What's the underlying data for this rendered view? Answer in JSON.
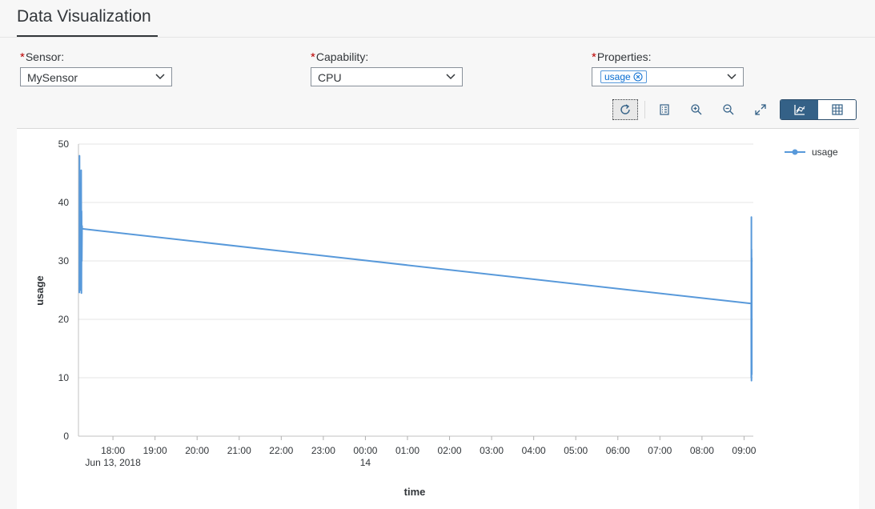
{
  "header": {
    "title": "Data Visualization"
  },
  "filters": {
    "sensor": {
      "label": "Sensor:",
      "required": "*",
      "value": "MySensor"
    },
    "capability": {
      "label": "Capability:",
      "required": "*",
      "value": "CPU"
    },
    "properties": {
      "label": "Properties:",
      "required": "*",
      "tokens": [
        "usage"
      ]
    }
  },
  "toolbar": {
    "icons": [
      "refresh-icon",
      "legend-list-icon",
      "zoom-in-icon",
      "zoom-out-icon",
      "fullscreen-icon",
      "chart-view-icon",
      "table-view-icon"
    ],
    "active_view": "chart"
  },
  "colors": {
    "accent": "#5899da",
    "active_segment": "#346187",
    "required": "#bb0000"
  },
  "chart_data": {
    "type": "line",
    "xlabel": "time",
    "ylabel": "usage",
    "ylim": [
      0,
      50
    ],
    "yticks": [
      0,
      10,
      20,
      30,
      40,
      50
    ],
    "xticks": [
      {
        "label": "18:00",
        "sub": "Jun 13, 2018",
        "t": 18.0
      },
      {
        "label": "19:00",
        "sub": "",
        "t": 19.0
      },
      {
        "label": "20:00",
        "sub": "",
        "t": 20.0
      },
      {
        "label": "21:00",
        "sub": "",
        "t": 21.0
      },
      {
        "label": "22:00",
        "sub": "",
        "t": 22.0
      },
      {
        "label": "23:00",
        "sub": "",
        "t": 23.0
      },
      {
        "label": "00:00",
        "sub": "14",
        "t": 24.0
      },
      {
        "label": "01:00",
        "sub": "",
        "t": 25.0
      },
      {
        "label": "02:00",
        "sub": "",
        "t": 26.0
      },
      {
        "label": "03:00",
        "sub": "",
        "t": 27.0
      },
      {
        "label": "04:00",
        "sub": "",
        "t": 28.0
      },
      {
        "label": "05:00",
        "sub": "",
        "t": 29.0
      },
      {
        "label": "06:00",
        "sub": "",
        "t": 30.0
      },
      {
        "label": "07:00",
        "sub": "",
        "t": 31.0
      },
      {
        "label": "08:00",
        "sub": "",
        "t": 32.0
      },
      {
        "label": "09:00",
        "sub": "",
        "t": 33.0
      }
    ],
    "xrange": [
      17.18,
      33.22
    ],
    "legend": {
      "position": "top-right"
    },
    "grid": true,
    "series": [
      {
        "name": "usage",
        "points": [
          [
            17.2,
            24.5
          ],
          [
            17.205,
            48.0
          ],
          [
            17.21,
            27.0
          ],
          [
            17.215,
            43.0
          ],
          [
            17.22,
            25.0
          ],
          [
            17.225,
            42.5
          ],
          [
            17.23,
            28.0
          ],
          [
            17.235,
            43.0
          ],
          [
            17.24,
            26.0
          ],
          [
            17.245,
            45.5
          ],
          [
            17.25,
            24.5
          ],
          [
            17.255,
            38.5
          ],
          [
            17.26,
            30.0
          ],
          [
            17.265,
            36.0
          ],
          [
            17.27,
            35.5
          ],
          [
            33.17,
            22.7
          ],
          [
            33.172,
            10.0
          ],
          [
            33.174,
            37.5
          ],
          [
            33.176,
            9.5
          ],
          [
            33.178,
            32.0
          ],
          [
            33.18,
            15.0
          ],
          [
            33.182,
            30.5
          ],
          [
            33.184,
            10.5
          ]
        ]
      }
    ]
  }
}
